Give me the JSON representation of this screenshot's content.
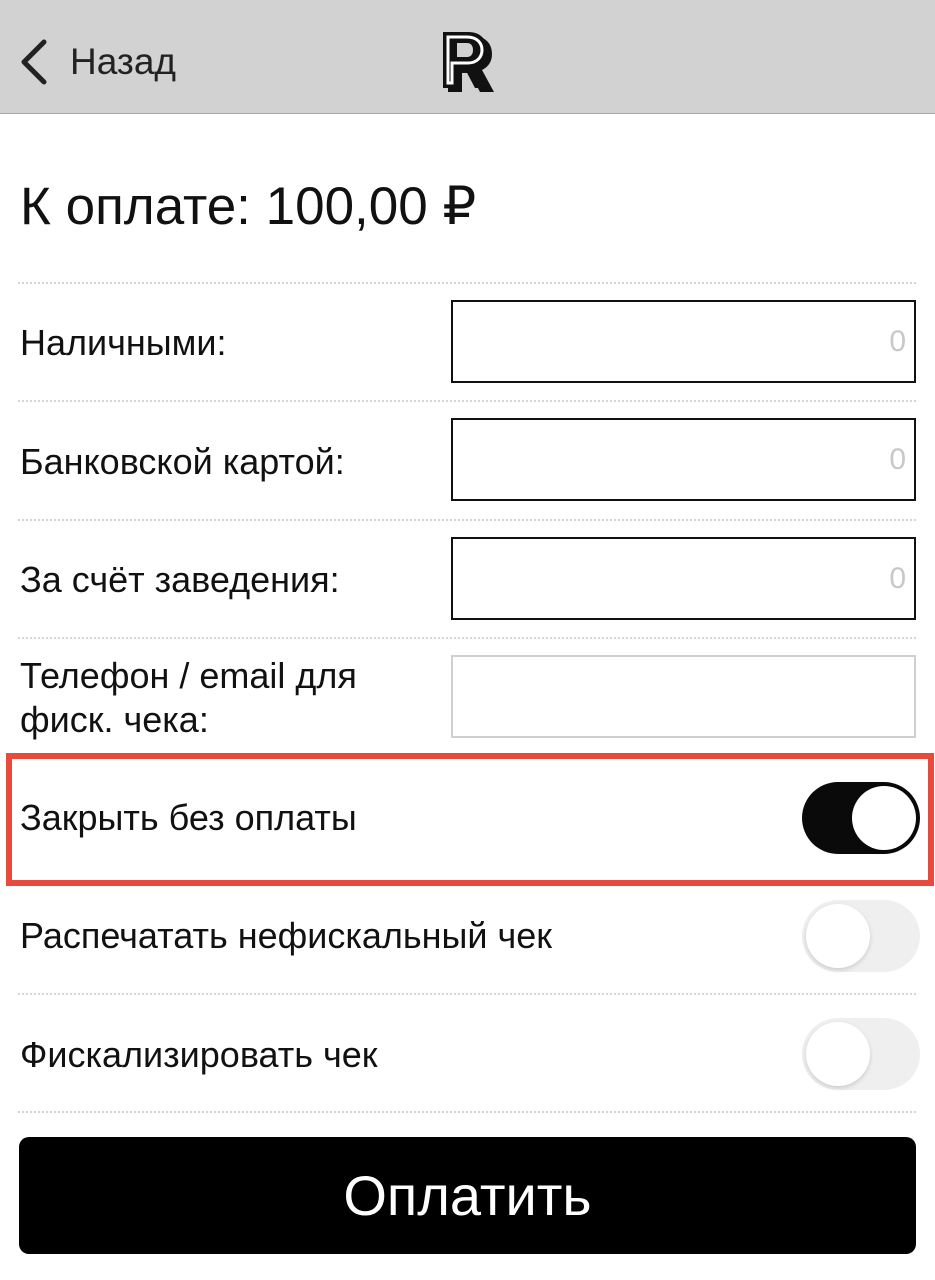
{
  "header": {
    "back_label": "Назад",
    "logo_letter": "R"
  },
  "amount": {
    "title": "К оплате: 100,00 ₽"
  },
  "payments": [
    {
      "label": "Наличными:",
      "value": "",
      "placeholder": "0"
    },
    {
      "label": "Банковской картой:",
      "value": "",
      "placeholder": "0"
    },
    {
      "label": "За счёт заведения:",
      "value": "",
      "placeholder": "0"
    }
  ],
  "contact": {
    "label_line1": "Телефон / email для",
    "label_line2": "фиск. чека:",
    "value": "",
    "placeholder": ""
  },
  "options": [
    {
      "label": "Закрыть без оплаты",
      "on": true
    },
    {
      "label": "Распечатать нефискальный чек",
      "on": false
    },
    {
      "label": "Фискализировать чек",
      "on": false
    }
  ],
  "pay_button": {
    "label": "Оплатить"
  },
  "colors": {
    "navbar": "#d2d2d2",
    "highlight": "#e84b3c",
    "toggle_on": "#0a0a0a",
    "toggle_off": "#efefef",
    "button": "#000000"
  }
}
